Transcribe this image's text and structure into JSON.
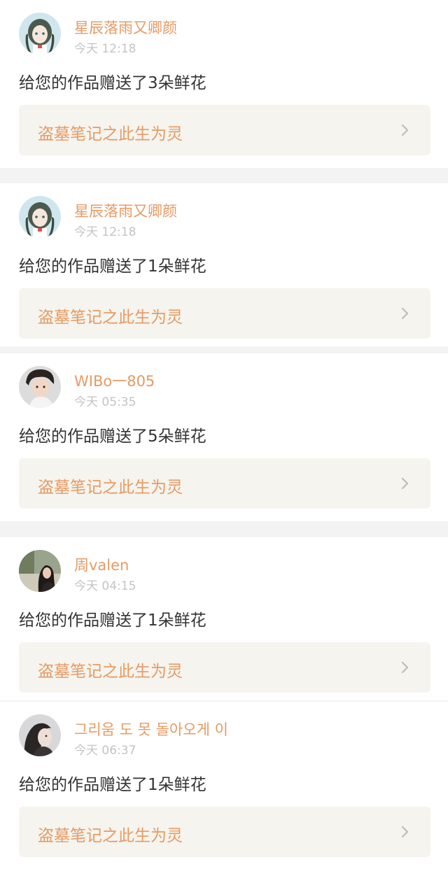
{
  "notifications": [
    {
      "username": "星辰落雨又卿颜",
      "time": "今天 12:18",
      "message": "给您的作品赠送了3朵鲜花",
      "work_title": "盗墓笔记之此生为灵",
      "avatar": "anime-girl-avatar"
    },
    {
      "username": "星辰落雨又卿颜",
      "time": "今天 12:18",
      "message": "给您的作品赠送了1朵鲜花",
      "work_title": "盗墓笔记之此生为灵",
      "avatar": "anime-girl-avatar"
    },
    {
      "username": "WIBo一805",
      "time": "今天 05:35",
      "message": "给您的作品赠送了5朵鲜花",
      "work_title": "盗墓笔记之此生为灵",
      "avatar": "young-man-avatar"
    },
    {
      "username": "周valen",
      "time": "今天 04:15",
      "message": "给您的作品赠送了1朵鲜花",
      "work_title": "盗墓笔记之此生为灵",
      "avatar": "woman-photo-avatar"
    },
    {
      "username": "그리움 도 못 돌아오게 이",
      "time": "今天 06:37",
      "message": "给您的作品赠送了1朵鲜花",
      "work_title": "盗墓笔记之此生为灵",
      "avatar": "portrait-avatar"
    }
  ],
  "colors": {
    "accent": "#e79a63",
    "time_text": "#c4c4c4",
    "body_text": "#333333",
    "link_card_bg": "#f5f4ee",
    "page_bg": "#f3f3f3"
  }
}
